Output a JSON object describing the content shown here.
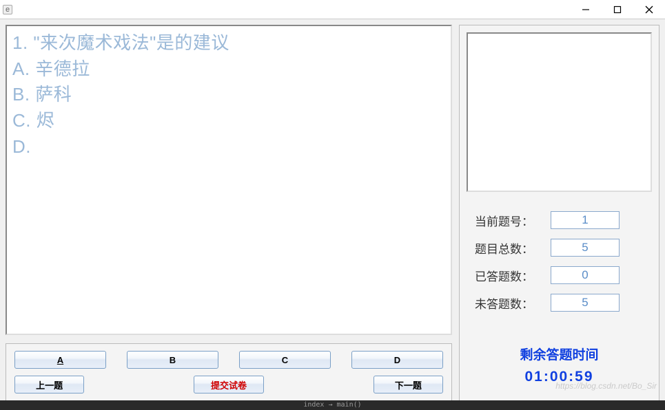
{
  "titlebar": {
    "icon_label": "e"
  },
  "question": {
    "number": "1.",
    "text": "\"来次魔术戏法\"是的建议",
    "options": {
      "a": "A. 辛德拉",
      "b": "B. 萨科",
      "c": "C. 烬",
      "d": "D."
    }
  },
  "answer_buttons": {
    "a": "A",
    "b": "B",
    "c": "C",
    "d": "D"
  },
  "nav_buttons": {
    "prev": "上一题",
    "submit": "提交试卷",
    "next": "下一题"
  },
  "stats": {
    "current_label": "当前题号：",
    "current_value": "1",
    "total_label": "题目总数：",
    "total_value": "5",
    "answered_label": "已答题数：",
    "answered_value": "0",
    "unanswered_label": "未答题数：",
    "unanswered_value": "5"
  },
  "timer": {
    "label": "剩余答题时间",
    "value": "01:00:59"
  },
  "watermark": "https://blog.csdn.net/Bo_Sir",
  "footer": "index → main()"
}
